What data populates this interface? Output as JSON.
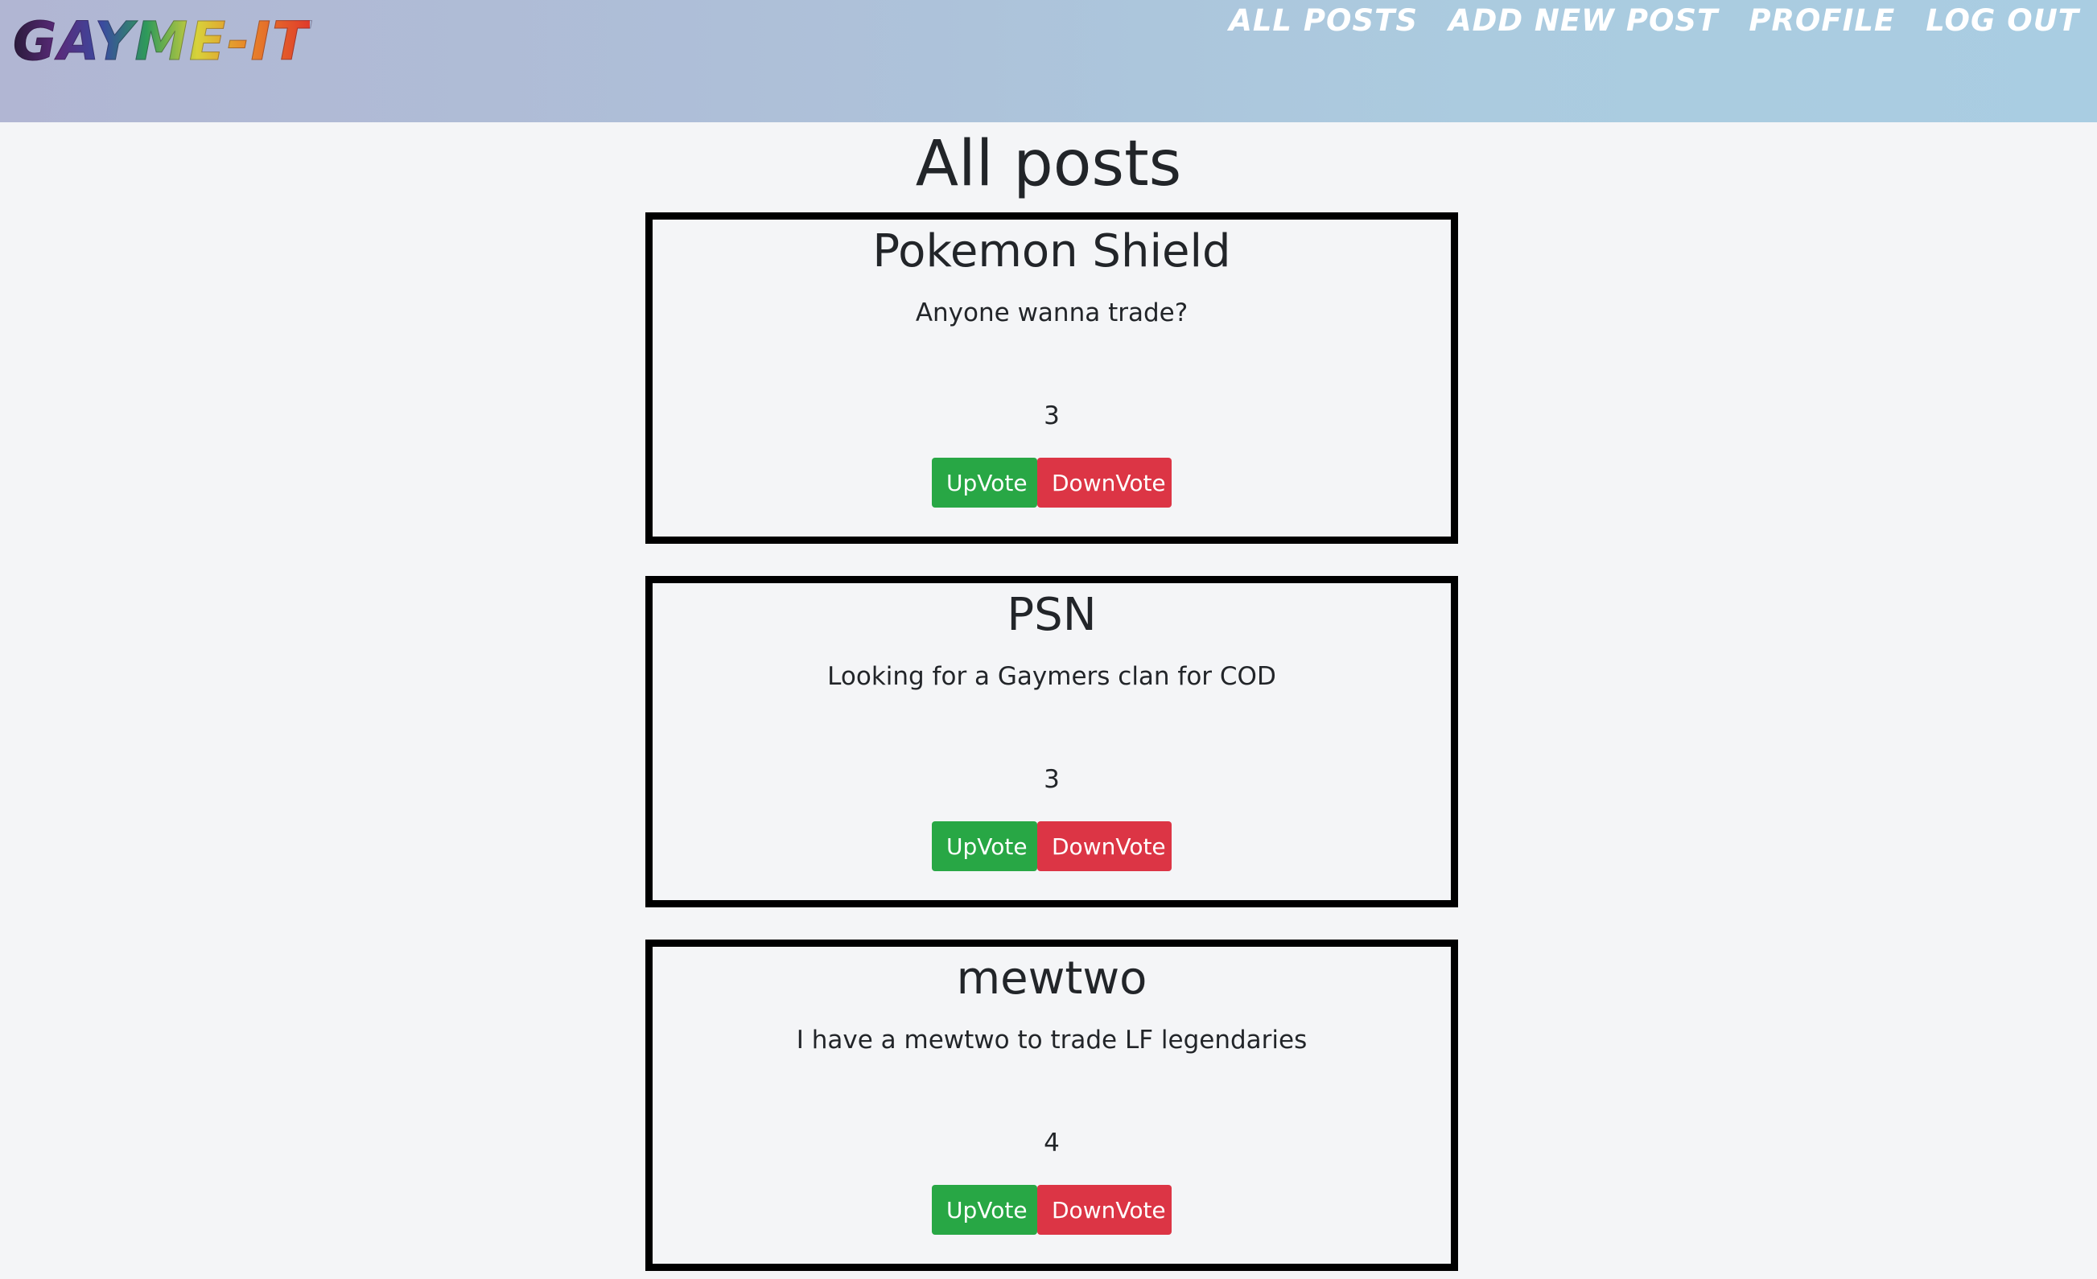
{
  "navbar": {
    "logo_text": "GAYME-IT",
    "links": [
      "All Posts",
      "Add New Post",
      "Profile",
      "Log Out"
    ]
  },
  "page": {
    "title": "All posts"
  },
  "posts": [
    {
      "title": "Pokemon Shield",
      "body": "Anyone wanna trade?",
      "votes": "3",
      "upvote_label": "UpVote",
      "downvote_label": "DownVote"
    },
    {
      "title": "PSN",
      "body": "Looking for a Gaymers clan for COD",
      "votes": "3",
      "upvote_label": "UpVote",
      "downvote_label": "DownVote"
    },
    {
      "title": "mewtwo",
      "body": "I have a mewtwo to trade LF legendaries",
      "votes": "4",
      "upvote_label": "UpVote",
      "downvote_label": "DownVote"
    }
  ],
  "colors": {
    "upvote": "#28a745",
    "downvote": "#dc3545",
    "card_border": "#000000",
    "background": "#f4f5f7"
  }
}
